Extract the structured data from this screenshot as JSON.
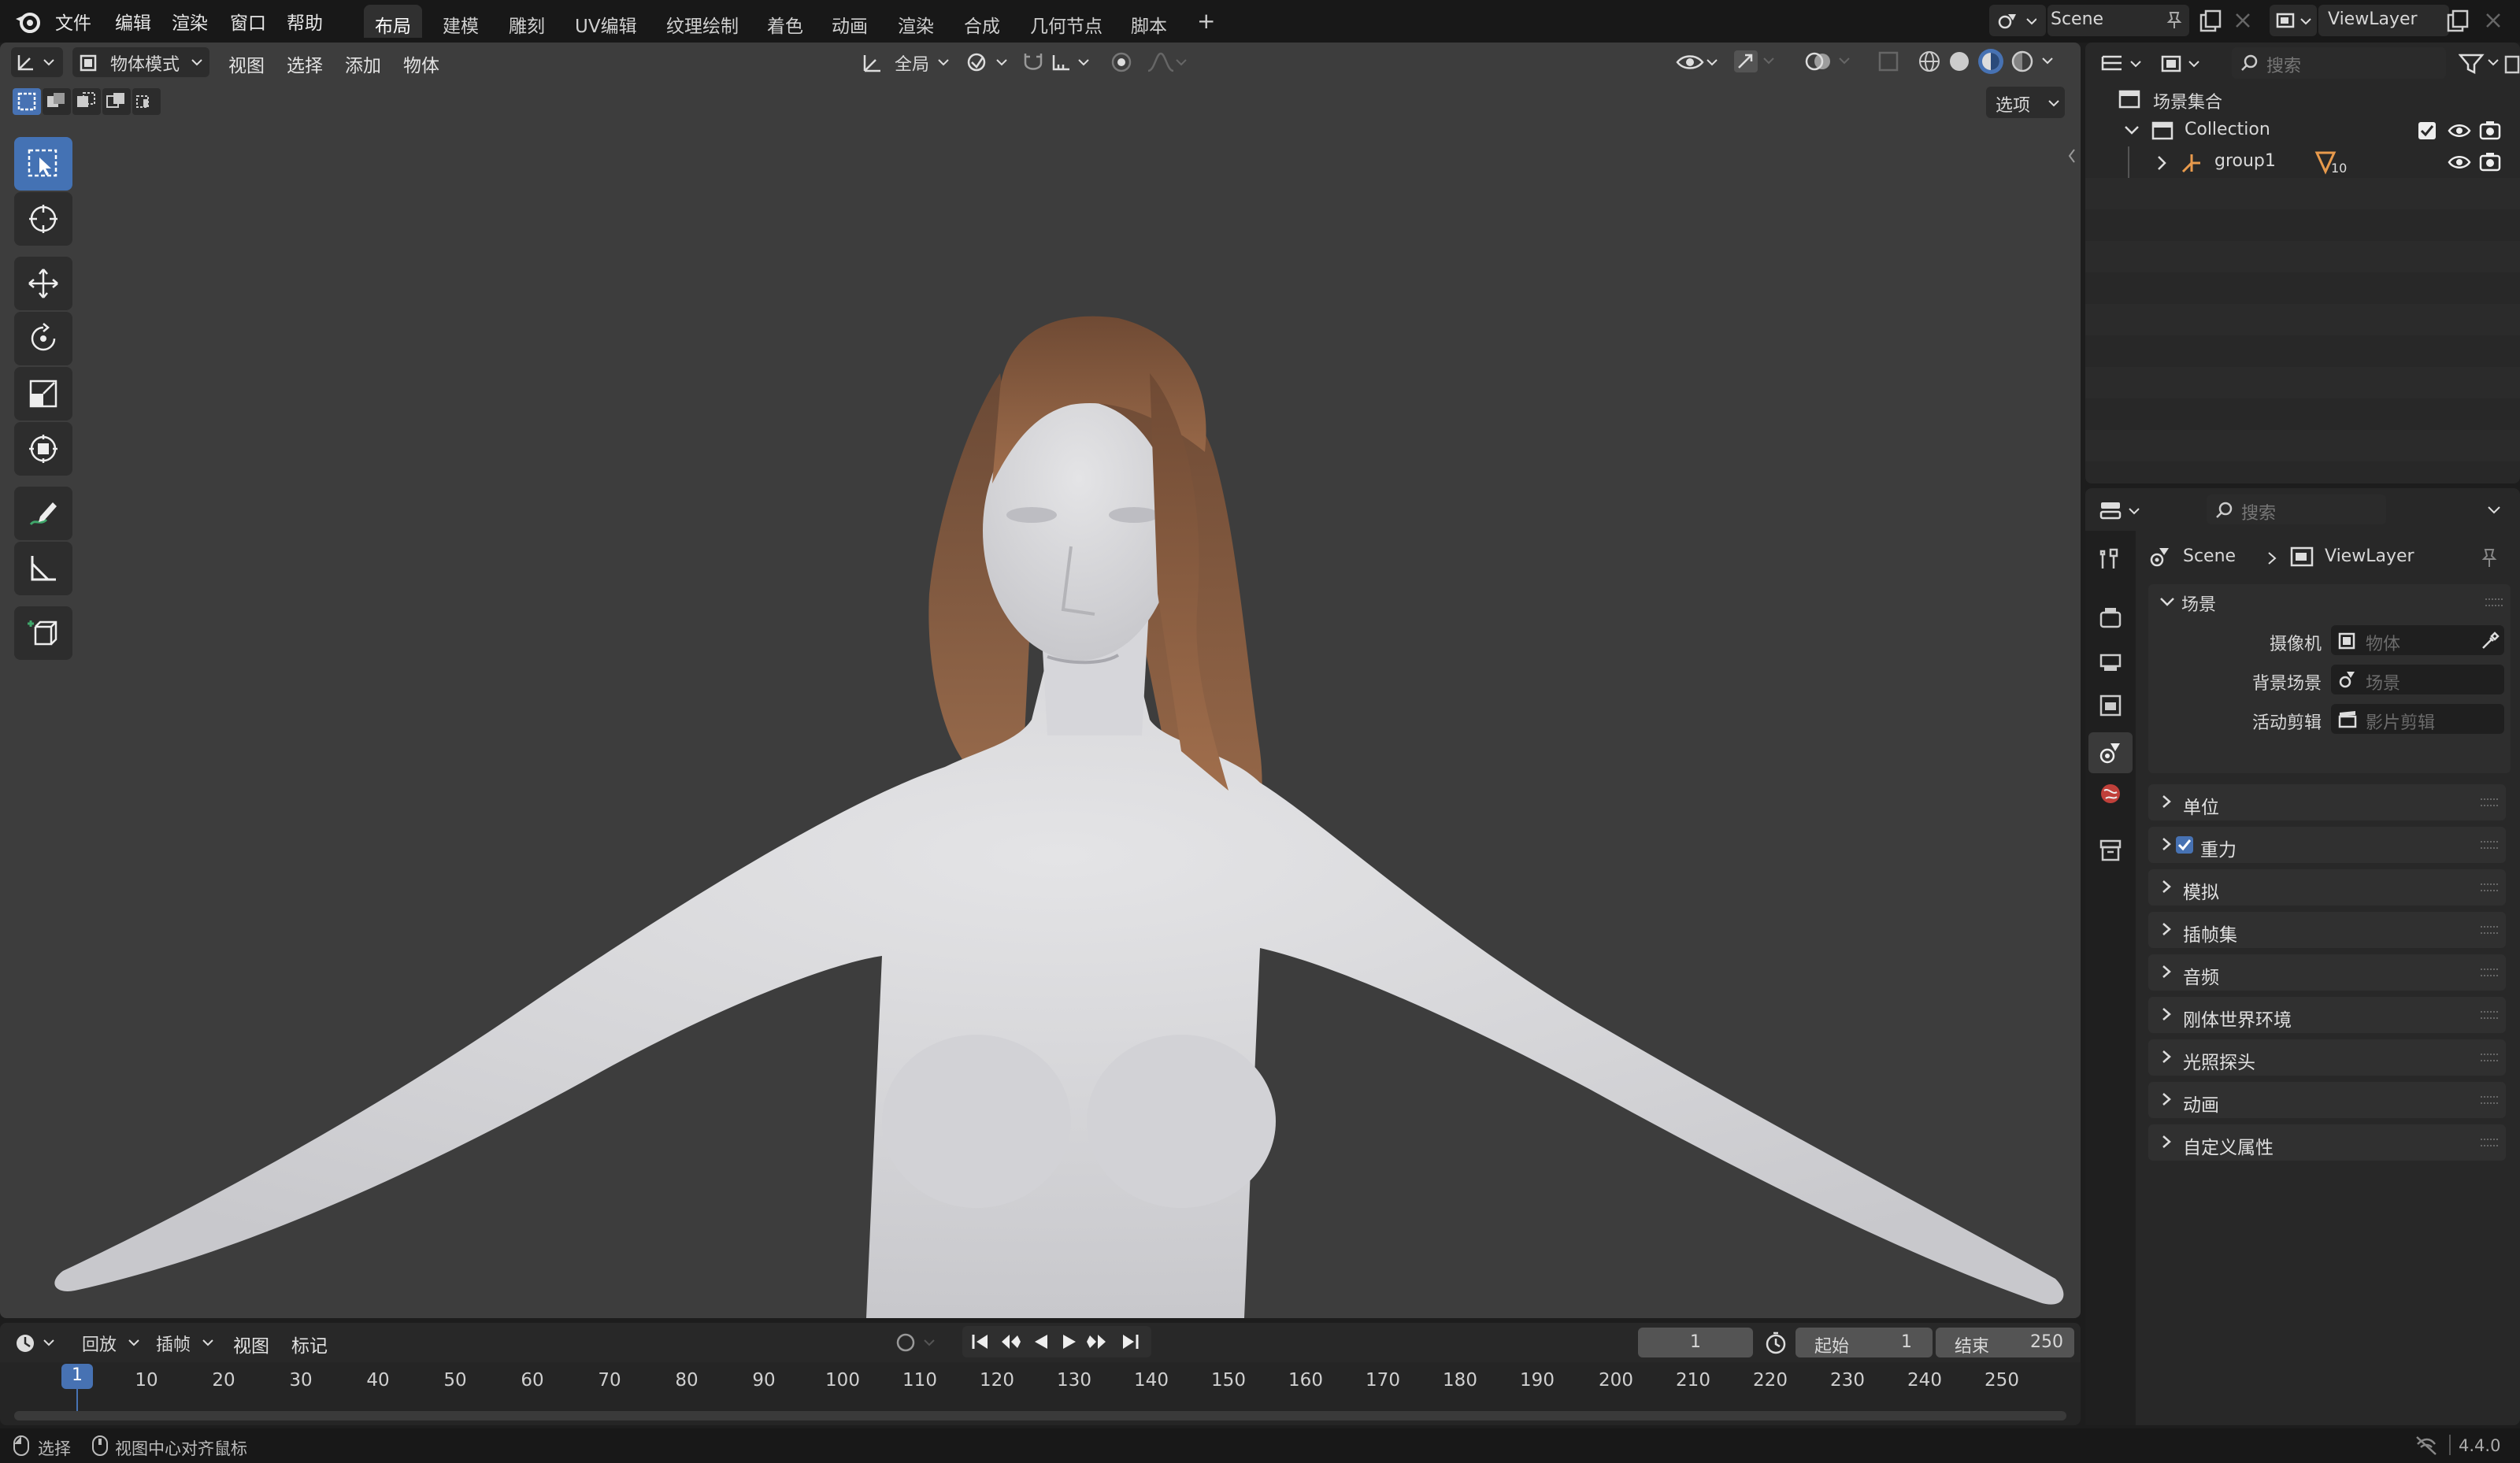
{
  "menu": {
    "items": [
      "文件",
      "编辑",
      "渲染",
      "窗口",
      "帮助"
    ]
  },
  "workspaces": {
    "tabs": [
      "布局",
      "建模",
      "雕刻",
      "UV编辑",
      "纹理绘制",
      "着色",
      "动画",
      "渲染",
      "合成",
      "几何节点",
      "脚本"
    ],
    "active": "布局",
    "add": "+"
  },
  "scene_selector": {
    "value": "Scene"
  },
  "viewlayer_selector": {
    "value": "ViewLayer"
  },
  "viewport": {
    "mode": "物体模式",
    "menus": [
      "视图",
      "选择",
      "添加",
      "物体"
    ],
    "transform_orientation": "全局",
    "options_button": "选项"
  },
  "outliner": {
    "search_placeholder": "搜索",
    "root": "场景集合",
    "collection": "Collection",
    "object": "group1",
    "object_badge": "10"
  },
  "properties": {
    "search_placeholder": "搜索",
    "breadcrumb": [
      "Scene",
      "ViewLayer"
    ],
    "section_title": "场景",
    "fields": [
      {
        "label": "摄像机",
        "placeholder": "物体"
      },
      {
        "label": "背景场景",
        "placeholder": "场景"
      },
      {
        "label": "活动剪辑",
        "placeholder": "影片剪辑"
      }
    ],
    "panels": [
      "单位",
      "重力",
      "模拟",
      "插帧集",
      "音频",
      "刚体世界环境",
      "光照探头",
      "动画",
      "自定义属性"
    ],
    "gravity_checked": true
  },
  "timeline": {
    "menus": [
      "回放",
      "插帧",
      "视图",
      "标记"
    ],
    "current_frame": "1",
    "start_label": "起始",
    "start": "1",
    "end_label": "结束",
    "end": "250",
    "ruler": [
      "10",
      "20",
      "30",
      "40",
      "50",
      "60",
      "70",
      "80",
      "90",
      "100",
      "110",
      "120",
      "130",
      "140",
      "150",
      "160",
      "170",
      "180",
      "190",
      "200",
      "210",
      "220",
      "230",
      "240",
      "250"
    ],
    "playhead": "1"
  },
  "statusbar": {
    "select": "选择",
    "center_view": "视图中心对齐鼠标",
    "version": "4.4.0"
  },
  "colors": {
    "accent": "#4772b3",
    "viewport_bg": "#3d3d3d",
    "panel_bg": "#282828",
    "hair": "#8a5a3c"
  }
}
